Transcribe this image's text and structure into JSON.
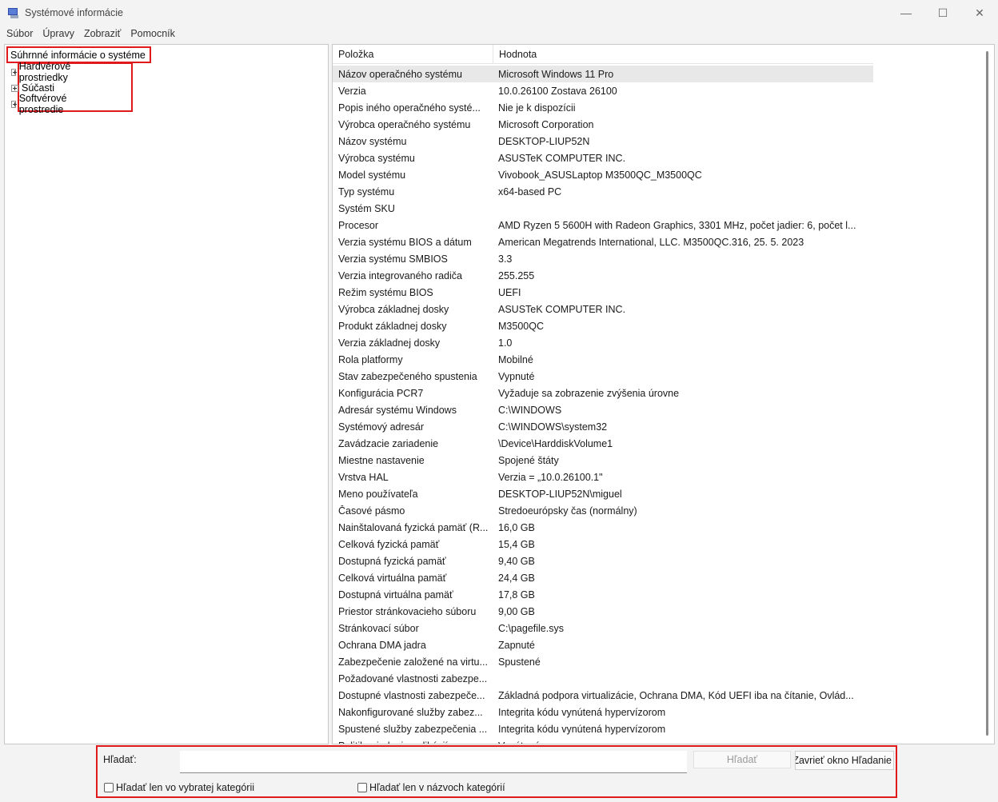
{
  "window": {
    "title": "Systémové informácie",
    "minimize_glyph": "—",
    "maximize_glyph": "☐",
    "close_glyph": "✕"
  },
  "menu": [
    "Súbor",
    "Úpravy",
    "Zobraziť",
    "Pomocník"
  ],
  "tree": {
    "root": "Súhrnné informácie o systéme",
    "children": [
      "Hardvérové prostriedky",
      "Súčasti",
      "Softvérové prostredie"
    ]
  },
  "list": {
    "columns": [
      "Položka",
      "Hodnota"
    ],
    "rows": [
      [
        "Názov operačného systému",
        "Microsoft Windows 11 Pro"
      ],
      [
        "Verzia",
        "10.0.26100 Zostava 26100"
      ],
      [
        "Popis iného operačného systé...",
        "Nie je k dispozícii"
      ],
      [
        "Výrobca operačného systému",
        "Microsoft Corporation"
      ],
      [
        "Názov systému",
        "DESKTOP-LIUP52N"
      ],
      [
        "Výrobca systému",
        "ASUSTeK COMPUTER INC."
      ],
      [
        "Model systému",
        "Vivobook_ASUSLaptop M3500QC_M3500QC"
      ],
      [
        "Typ systému",
        "x64-based PC"
      ],
      [
        "Systém SKU",
        ""
      ],
      [
        "Procesor",
        "AMD Ryzen 5 5600H with Radeon Graphics, 3301 MHz, počet jadier: 6, počet l..."
      ],
      [
        "Verzia systému BIOS a dátum",
        "American Megatrends International, LLC. M3500QC.316, 25. 5. 2023"
      ],
      [
        "Verzia systému SMBIOS",
        "3.3"
      ],
      [
        "Verzia integrovaného radiča",
        "255.255"
      ],
      [
        "Režim systému BIOS",
        "UEFI"
      ],
      [
        "Výrobca základnej dosky",
        "ASUSTeK COMPUTER INC."
      ],
      [
        "Produkt základnej dosky",
        "M3500QC"
      ],
      [
        "Verzia základnej dosky",
        "1.0"
      ],
      [
        "Rola platformy",
        "Mobilné"
      ],
      [
        "Stav zabezpečeného spustenia",
        "Vypnuté"
      ],
      [
        "Konfigurácia PCR7",
        "Vyžaduje sa zobrazenie zvýšenia úrovne"
      ],
      [
        "Adresár systému Windows",
        "C:\\WINDOWS"
      ],
      [
        "Systémový adresár",
        "C:\\WINDOWS\\system32"
      ],
      [
        "Zavádzacie zariadenie",
        "\\Device\\HarddiskVolume1"
      ],
      [
        "Miestne nastavenie",
        "Spojené štáty"
      ],
      [
        "Vrstva HAL",
        "Verzia = „10.0.26100.1\""
      ],
      [
        "Meno používateľa",
        "DESKTOP-LIUP52N\\miguel"
      ],
      [
        "Časové pásmo",
        "Stredoeurópsky čas (normálny)"
      ],
      [
        "Nainštalovaná fyzická pamäť (R...",
        "16,0 GB"
      ],
      [
        "Celková fyzická pamäť",
        "15,4 GB"
      ],
      [
        "Dostupná fyzická pamäť",
        "9,40 GB"
      ],
      [
        "Celková virtuálna pamäť",
        "24,4 GB"
      ],
      [
        "Dostupná virtuálna pamäť",
        "17,8 GB"
      ],
      [
        "Priestor stránkovacieho súboru",
        "9,00 GB"
      ],
      [
        "Stránkovací súbor",
        "C:\\pagefile.sys"
      ],
      [
        "Ochrana DMA jadra",
        "Zapnuté"
      ],
      [
        "Zabezpečenie založené na virtu...",
        "Spustené"
      ],
      [
        "Požadované vlastnosti zabezpe...",
        ""
      ],
      [
        "Dostupné vlastnosti zabezpeče...",
        "Základná podpora virtualizácie, Ochrana DMA, Kód UEFI iba na čítanie, Ovlád..."
      ],
      [
        "Nakonfigurované služby zabez...",
        "Integrita kódu vynútená hypervízorom"
      ],
      [
        "Spustené služby zabezpečenia ...",
        "Integrita kódu vynútená hypervízorom"
      ],
      [
        "Politika riadenia aplikácií pre ...",
        "Vynútené"
      ]
    ]
  },
  "search": {
    "label": "Hľadať:",
    "value": "",
    "find_button": "Hľadať",
    "close_button": "Zavrieť okno Hľadanie",
    "checkbox_selected_category": "Hľadať len vo vybratej kategórii",
    "checkbox_category_names": "Hľadať len v názvoch kategórií"
  }
}
